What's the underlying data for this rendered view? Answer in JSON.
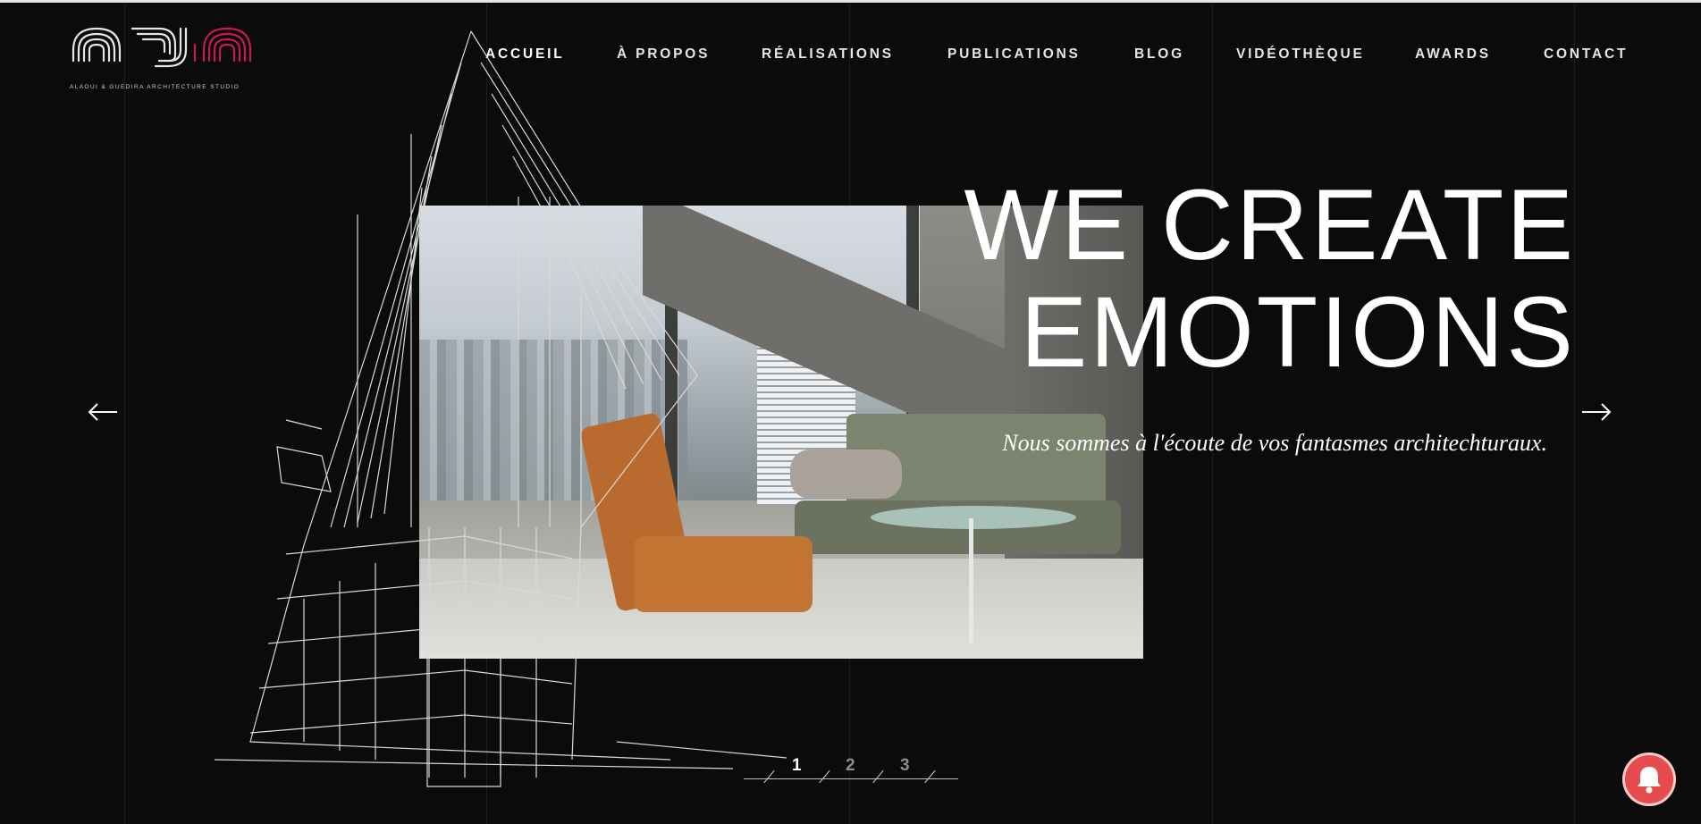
{
  "logo": {
    "caption": "ALAOUI & GUEDIRA ARCHITECTURE STUDIO"
  },
  "nav": {
    "items": [
      {
        "label": "ACCUEIL",
        "active": true
      },
      {
        "label": "À PROPOS",
        "active": false
      },
      {
        "label": "RÉALISATIONS",
        "active": false
      },
      {
        "label": "PUBLICATIONS",
        "active": false
      },
      {
        "label": "BLOG",
        "active": false
      },
      {
        "label": "VIDÉOTHÈQUE",
        "active": false
      },
      {
        "label": "AWARDS",
        "active": false
      },
      {
        "label": "CONTACT",
        "active": false
      }
    ]
  },
  "hero": {
    "title_line1": "WE CREATE",
    "title_line2": "EMOTIONS",
    "subtitle": "Nous sommes à l'écoute de vos fantasmes architechturaux."
  },
  "slider": {
    "pages": [
      "1",
      "2",
      "3"
    ],
    "current_page": "1",
    "prev_icon": "arrow-left-icon",
    "next_icon": "arrow-right-icon"
  },
  "notification": {
    "icon": "bell-icon"
  },
  "colors": {
    "background": "#0b0b0c",
    "accent": "#c8185a",
    "text": "#ffffff",
    "bell": "#e64b4e"
  }
}
